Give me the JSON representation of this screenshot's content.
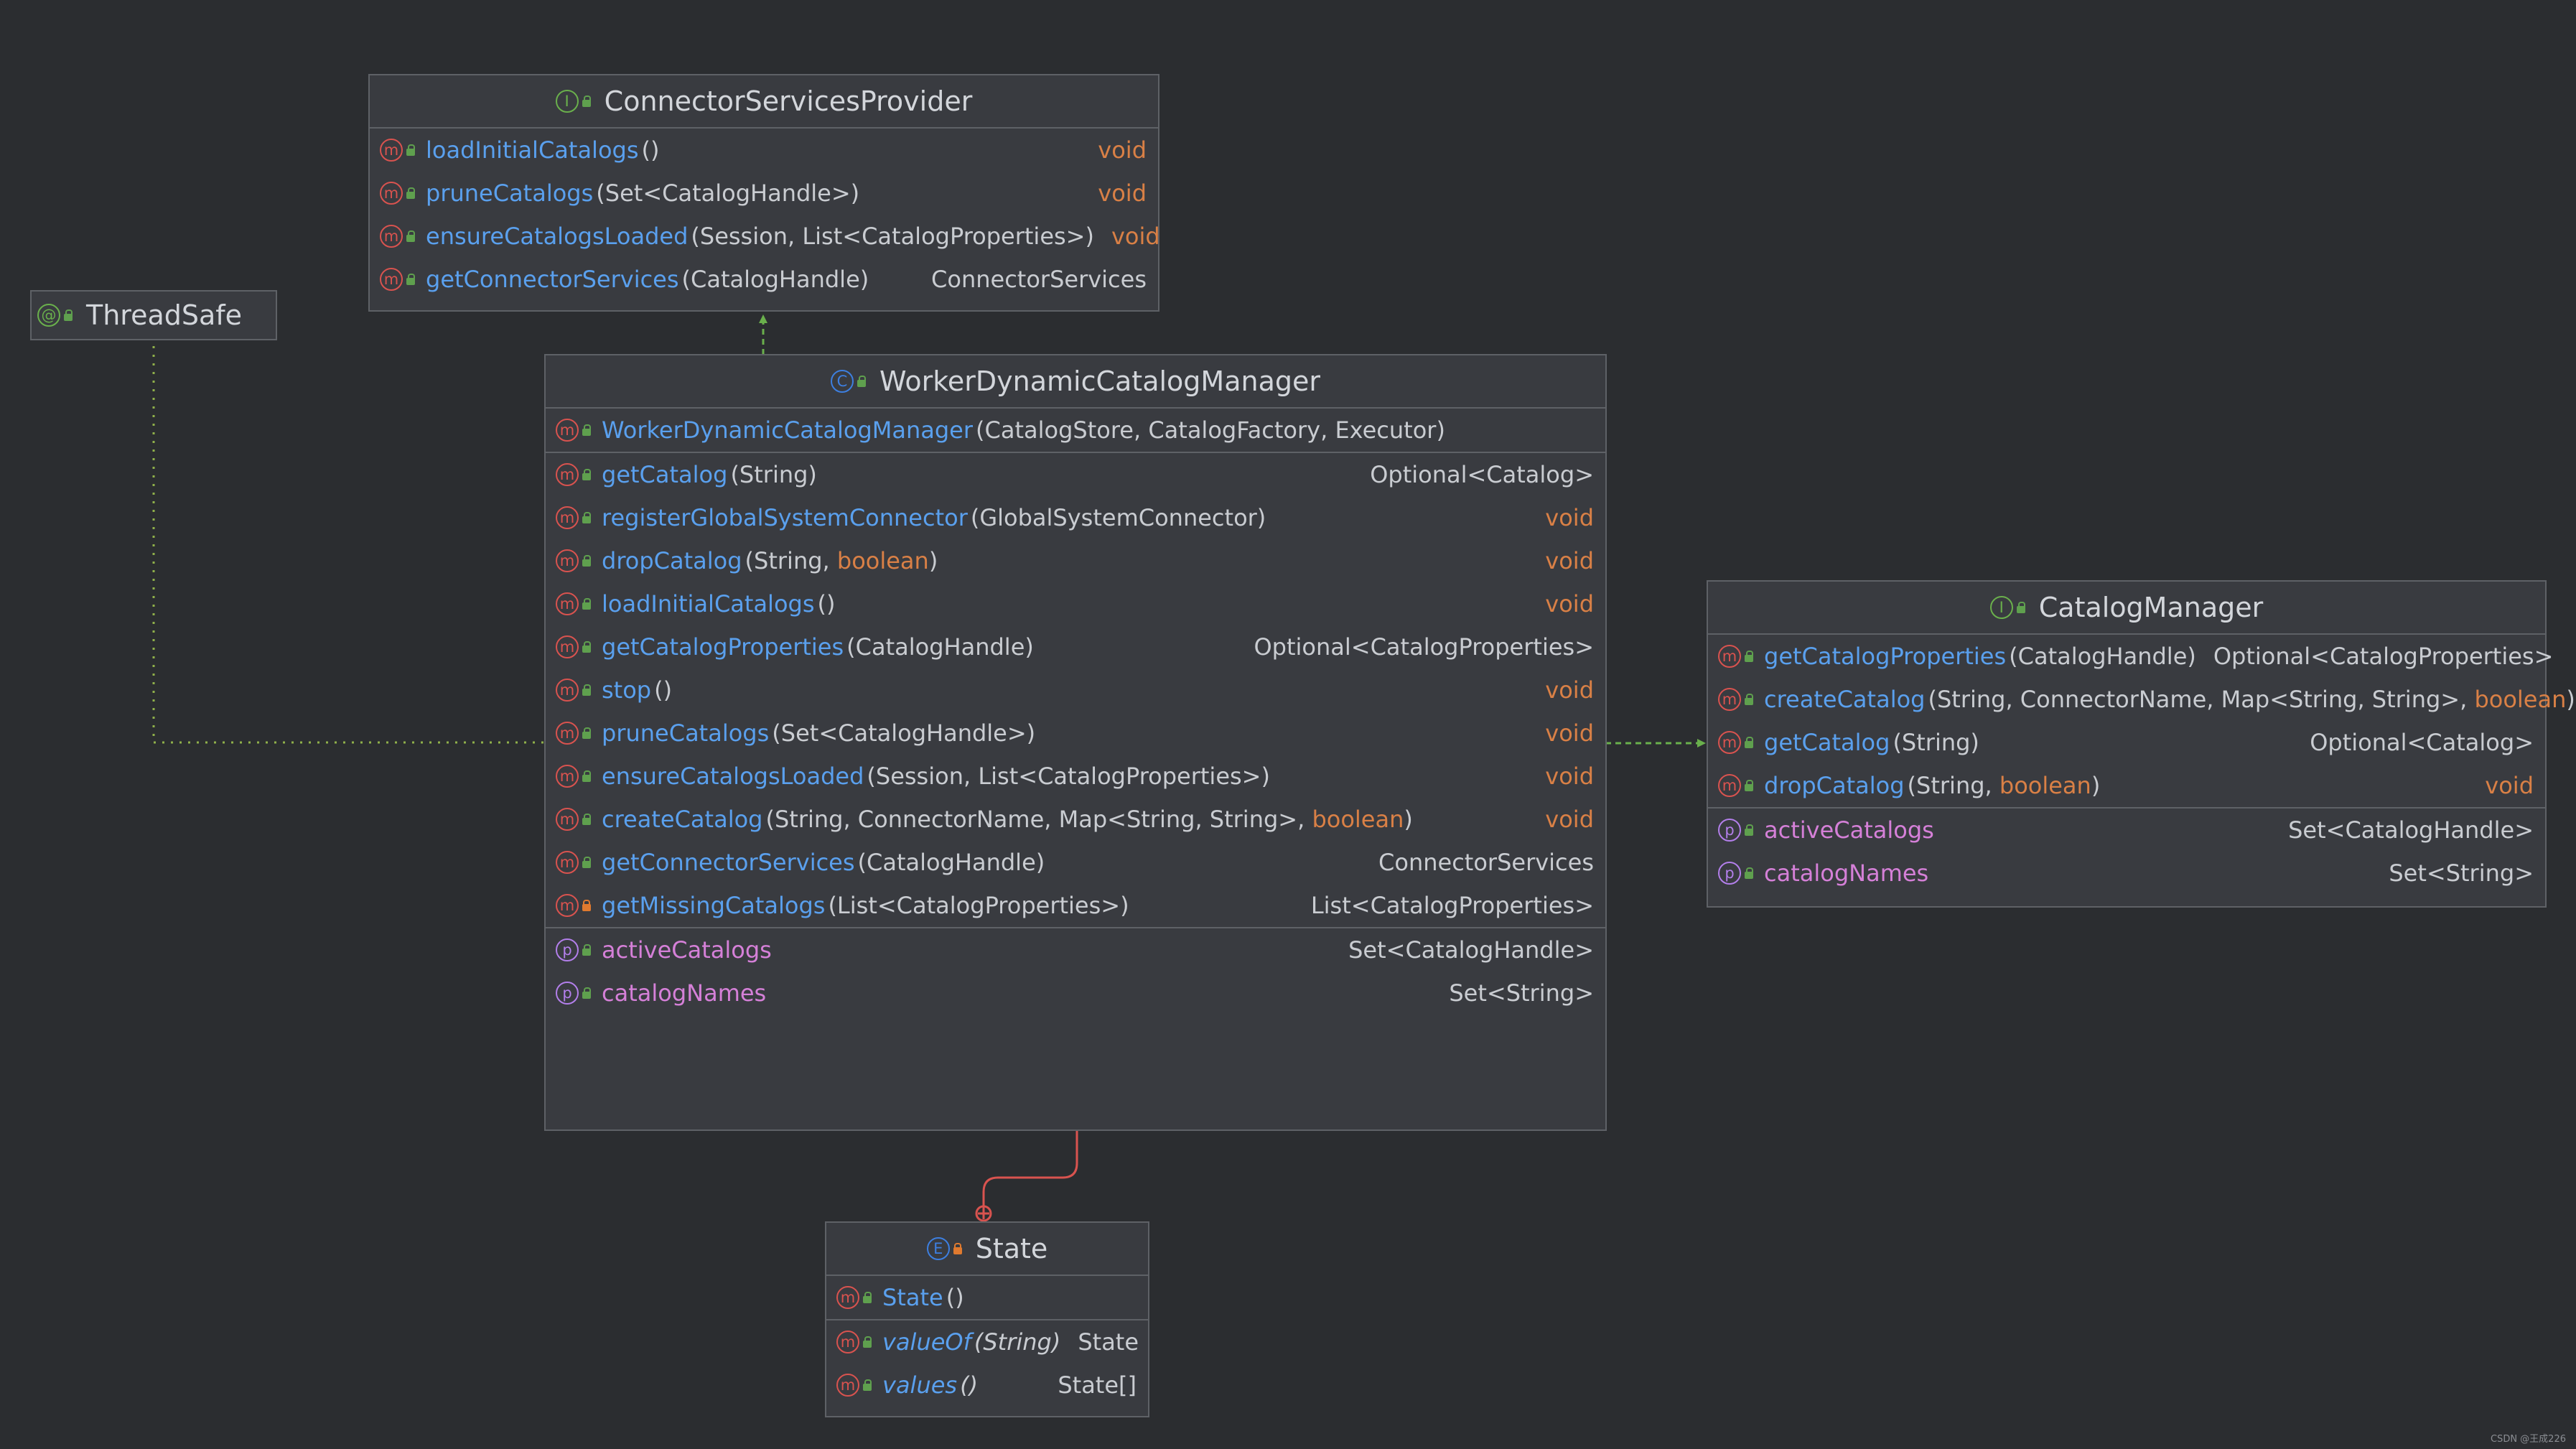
{
  "colors": {
    "background": "#2b2d30",
    "box": "#393b40",
    "method_name": "#5aa0ee",
    "property_name": "#d580d8",
    "keyword": "#d98046",
    "implements_arrow": "#6ab04c",
    "dependency_line": "#d9534f"
  },
  "diagram": {
    "thread_safe": {
      "icon": "annotation-icon",
      "title": "ThreadSafe"
    },
    "connector_services_provider": {
      "icon": "interface-icon",
      "title": "ConnectorServicesProvider",
      "methods": [
        {
          "name": "loadInitialCatalogs",
          "params": "()",
          "ret": "void",
          "ret_kw": true
        },
        {
          "name": "pruneCatalogs",
          "params": "(Set<CatalogHandle>)",
          "ret": "void",
          "ret_kw": true
        },
        {
          "name": "ensureCatalogsLoaded",
          "params": "(Session, List<CatalogProperties>)",
          "ret": "void",
          "ret_kw": true
        },
        {
          "name": "getConnectorServices",
          "params": "(CatalogHandle)",
          "ret": "ConnectorServices",
          "ret_kw": false
        }
      ]
    },
    "worker_dynamic_catalog_manager": {
      "icon": "class-icon",
      "title": "WorkerDynamicCatalogManager",
      "constructor": {
        "name": "WorkerDynamicCatalogManager",
        "params": "(CatalogStore, CatalogFactory, Executor)"
      },
      "methods": [
        {
          "name": "getCatalog",
          "params": "(String)",
          "ret": "Optional<Catalog>",
          "ret_kw": false
        },
        {
          "name": "registerGlobalSystemConnector",
          "params": "(GlobalSystemConnector)",
          "ret": "void",
          "ret_kw": true
        },
        {
          "name": "dropCatalog",
          "params_pre": "(String, ",
          "params_kw": "boolean",
          "params_post": ")",
          "ret": "void",
          "ret_kw": true
        },
        {
          "name": "loadInitialCatalogs",
          "params": "()",
          "ret": "void",
          "ret_kw": true
        },
        {
          "name": "getCatalogProperties",
          "params": "(CatalogHandle)",
          "ret": "Optional<CatalogProperties>",
          "ret_kw": false
        },
        {
          "name": "stop",
          "params": "()",
          "ret": "void",
          "ret_kw": true
        },
        {
          "name": "pruneCatalogs",
          "params": "(Set<CatalogHandle>)",
          "ret": "void",
          "ret_kw": true
        },
        {
          "name": "ensureCatalogsLoaded",
          "params": "(Session, List<CatalogProperties>)",
          "ret": "void",
          "ret_kw": true
        },
        {
          "name": "createCatalog",
          "params_pre": "(String, ConnectorName, Map<String, String>, ",
          "params_kw": "boolean",
          "params_post": ")",
          "ret": "void",
          "ret_kw": true
        },
        {
          "name": "getConnectorServices",
          "params": "(CatalogHandle)",
          "ret": "ConnectorServices",
          "ret_kw": false
        },
        {
          "name": "getMissingCatalogs",
          "params": "(List<CatalogProperties>)",
          "ret": "List<CatalogProperties>",
          "ret_kw": false,
          "private": true
        }
      ],
      "properties": [
        {
          "name": "activeCatalogs",
          "ret": "Set<CatalogHandle>"
        },
        {
          "name": "catalogNames",
          "ret": "Set<String>"
        }
      ]
    },
    "catalog_manager": {
      "icon": "interface-icon",
      "title": "CatalogManager",
      "methods": [
        {
          "name": "getCatalogProperties",
          "params": "(CatalogHandle)",
          "ret": "Optional<CatalogProperties>",
          "ret_kw": false
        },
        {
          "name": "createCatalog",
          "params_pre": "(String, ConnectorName, Map<String, String>, ",
          "params_kw": "boolean",
          "params_post": ")",
          "ret": "",
          "ret_kw": false
        },
        {
          "name": "getCatalog",
          "params": "(String)",
          "ret": "Optional<Catalog>",
          "ret_kw": false
        },
        {
          "name": "dropCatalog",
          "params_pre": "(String, ",
          "params_kw": "boolean",
          "params_post": ")",
          "ret": "void",
          "ret_kw": true
        }
      ],
      "properties": [
        {
          "name": "activeCatalogs",
          "ret": "Set<CatalogHandle>"
        },
        {
          "name": "catalogNames",
          "ret": "Set<String>"
        }
      ]
    },
    "state": {
      "icon": "enum-icon",
      "title": "State",
      "constructor": {
        "name": "State",
        "params": "()"
      },
      "methods": [
        {
          "name": "valueOf",
          "params": "(String)",
          "ret": "State",
          "ret_kw": false,
          "static": true
        },
        {
          "name": "values",
          "params": "()",
          "ret": "State[]",
          "ret_kw": false,
          "static": true
        }
      ]
    }
  },
  "watermark": "CSDN @王成226"
}
